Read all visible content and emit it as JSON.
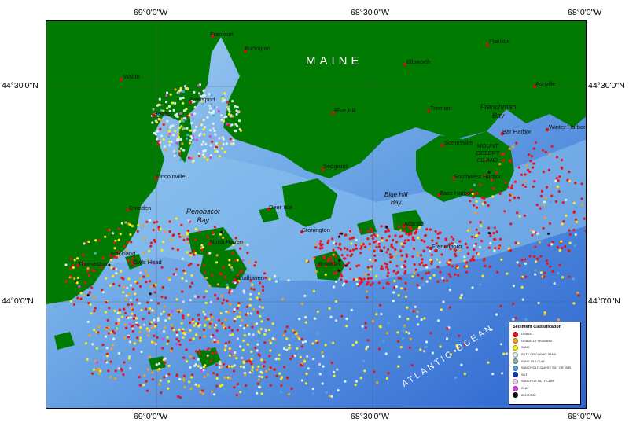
{
  "axes": {
    "top_labels": [
      "69°0'0\"W",
      "68°30'0\"W",
      "68°0'0\"W"
    ],
    "bottom_labels": [
      "69°0'0\"W",
      "68°30'0\"W",
      "68°0'0\"W"
    ],
    "left_labels": [
      "44°30'0\"N",
      "44°0'0\"N"
    ],
    "right_labels": [
      "44°30'0\"N",
      "44°0'0\"N"
    ]
  },
  "map": {
    "state_label": "MAINE",
    "ocean_label": "ATLANTIC OCEAN",
    "places": {
      "frankfort": "Frankfort",
      "bucksport": "Bucksport",
      "waldo": "Waldo",
      "ellsworth": "Ellsworth",
      "franklin": "Franklin",
      "ashville": "Ashville",
      "searsport": "Searsport",
      "belfast": "Belfast",
      "blue_hill": "Blue Hill",
      "tremont": "Tremont",
      "winter_harbor": "Winter Harbor",
      "bar_harbor": "Bar Harbor",
      "somesville": "Somesville",
      "lincolnville": "Lincolnville",
      "sedgwick": "Sedgwick",
      "camden": "Camden",
      "north_haven": "North Haven",
      "rockland": "Rockland",
      "owls_head": "Owls Head",
      "thomaston": "Thomaston",
      "vinalhaven": "Vinalhaven",
      "stonington": "Stonington",
      "deer_isle": "Deer Isle",
      "brooklin": "Brooklin",
      "atlantic": "Atlantic",
      "frenchboro": "Frenchboro",
      "bass_harbor": "Bass Harbor",
      "southwest_harbor": "Southwest Harbor"
    },
    "water_labels": {
      "frenchman_bay": [
        "Frenchman",
        "Bay"
      ],
      "mount_desert_island": [
        "MOUNT",
        "DESERT",
        "ISLAND"
      ],
      "penobscot_bay": [
        "Penobscot",
        "Bay"
      ],
      "blue_hill_bay": [
        "Blue Hill",
        "Bay"
      ]
    }
  },
  "legend": {
    "title": "Sediment Classification",
    "items": [
      {
        "label": "GRAVEL",
        "color": "#e8141b"
      },
      {
        "label": "GRAVELLY SEDIMENT",
        "color": "#f0a21c"
      },
      {
        "label": "SAND",
        "color": "#f5ee1f"
      },
      {
        "label": "SILTY OR CLAYEY SAND",
        "color": "#d9f0ec"
      },
      {
        "label": "SAND SILT CLAY",
        "color": "#8fb4a8"
      },
      {
        "label": "SANDY SILT, CLAYEY SILT OR MUD",
        "color": "#4fa6d6"
      },
      {
        "label": "SILT",
        "color": "#1032c8"
      },
      {
        "label": "SANDY OR SILTY CLAY",
        "color": "#e8c8ee"
      },
      {
        "label": "CLAY",
        "color": "#e23ee6"
      },
      {
        "label": "BEDROCK",
        "color": "#111111"
      }
    ]
  },
  "colors": {
    "land": "#007a00",
    "shallow_water": "#9fd0f0",
    "mid_water": "#5b95e0",
    "deep_water": "#2f6fd2"
  }
}
